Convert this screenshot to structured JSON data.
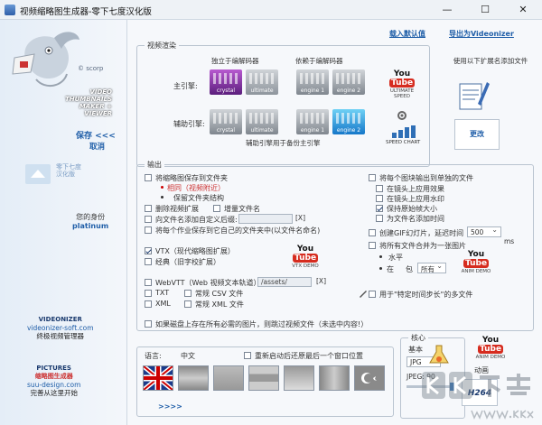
{
  "window": {
    "title": "视频缩略图生成器-零下七度汉化版",
    "min_label": "—",
    "max_label": "☐",
    "close_label": "✕"
  },
  "sidebar": {
    "scorp": "© scorp",
    "logo_lines": [
      "VIDEO",
      "THUMBNAILS",
      "MAKER + VIEWER"
    ],
    "save_label": "保存 <<<",
    "cancel_label": "取消",
    "mini_text": [
      "零下七度",
      "汉化版"
    ],
    "profile_label": "您的身份",
    "profile_value": "platinum",
    "credit1": {
      "heading": "VIDEONIZER",
      "url": "videonizer-soft.com",
      "desc": "终极视频管理器"
    },
    "credit2": {
      "heading": "PICTURES",
      "sub": "缩略图生成器",
      "url": "suu-design.com",
      "desc": "完善从这里开始"
    }
  },
  "top_links": {
    "load_defaults": "载入默认值",
    "export_videonizer": "导出为Videonizer"
  },
  "render": {
    "legend": "视频渲染",
    "independent_label": "独立于编解码器",
    "dependent_label": "依赖于编解码器",
    "main_engine_label": "主引擎:",
    "aux_engine_label": "辅助引擎:",
    "aux_note": "辅助引擎用于备份主引擎",
    "engines": [
      "crystal",
      "ultimate",
      "engine 1",
      "engine 2"
    ],
    "youtube_sub": "ULTIMATE SPEED",
    "speed_chart": "SPEED CHART"
  },
  "ext_panel": {
    "text": "使用以下扩展名添加文件",
    "update_label": "更改"
  },
  "output": {
    "legend": "输出",
    "save_to_folder": "将缩略图保存到文件夹",
    "opt_same": "相同（视频附近）",
    "opt_keep": "保留文件夹结构",
    "delete_ext": "删除视频扩展",
    "add_name": "增量文件名",
    "add_suffix": "向文件名添加自定义后缀:",
    "suffix_btn": "[X]",
    "save_sub": "将每个作业保存到它自己的文件夹中(以文件名命名)",
    "vtx_modern": "VTX（现代缩略图扩展）",
    "vtx_classic": "经典（旧字校扩展）",
    "vtx_demo": "VTX DEMO",
    "webvtt": "WebVTT（Web 视频文本轨道）:",
    "webvtt_path": "/assets/",
    "webvtt_x": "[X]",
    "txt": "TXT",
    "csv": "常规 CSV 文件",
    "xml": "XML",
    "xml2": "常规 XML 文件",
    "right_title": "将每个图块输出到单独的文件",
    "r_opt1": "在镜头上应用效果",
    "r_opt2": "在镜头上应用水印",
    "r_opt3": "保持原始帧大小",
    "r_opt4": "为文件名添加时间",
    "gif": "创建GIF幻灯片，延迟时间",
    "gif_value": "500",
    "gif_unit": "ms",
    "merge": "将所有文件合并为一张图片",
    "merge_h": "水平",
    "merge_in": "在",
    "merge_pkg": "包",
    "merge_sel": "所有",
    "anim_demo": "ANIM DEMO",
    "special_step": "用于\"特定时间步长\"的多文件"
  },
  "footer_line": "如果磁盘上存在所有必需的图片，则跳过视频文件（未选中内容!）",
  "language": {
    "label": "语言:",
    "value": "中文",
    "restart_label": "重新启动后还原最后一个窗口位置",
    "more": ">>>>"
  },
  "core": {
    "legend": "核心",
    "basic": "基本",
    "format": "JPG",
    "quality_label": "JPEG: 90",
    "anim_label": "动画",
    "h264": "H264"
  },
  "watermark": {
    "brand": "kk下载",
    "url": "www.kkx.net"
  }
}
